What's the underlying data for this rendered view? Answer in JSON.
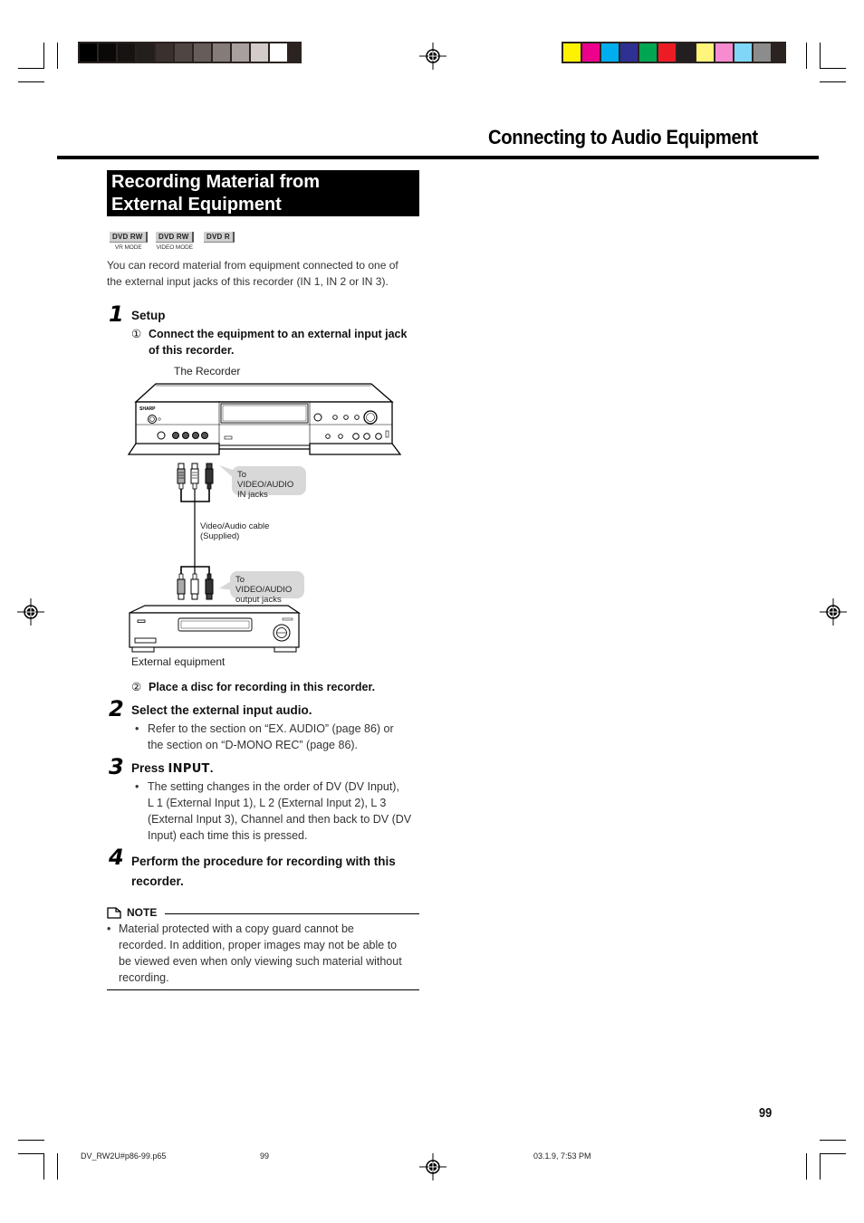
{
  "print_marks": {
    "gray_swatches": [
      "#000000",
      "#0b0908",
      "#161312",
      "#221f1c",
      "#3a302d",
      "#4f4643",
      "#665d5a",
      "#857b78",
      "#a8a09e",
      "#d2cbca",
      "#ffffff"
    ],
    "color_swatches": [
      "#fff200",
      "#ec008c",
      "#00aeef",
      "#2e3192",
      "#00a651",
      "#ed1c24",
      "#231f20",
      "#fff57a",
      "#f68bd0",
      "#7fd6f7",
      "#8c8c8c"
    ]
  },
  "header": {
    "chapter_title": "Connecting to Audio Equipment"
  },
  "section": {
    "title_line1": "Recording Material from",
    "title_line2": "External Equipment",
    "badges": [
      {
        "label": "DVD RW",
        "sub": "VR MODE"
      },
      {
        "label": "DVD RW",
        "sub": "VIDEO MODE"
      },
      {
        "label": "DVD R",
        "sub": ""
      }
    ],
    "intro_line1": "You can record material from equipment connected to one of",
    "intro_line2": "the external input jacks of this recorder (IN 1, IN 2 or IN 3)."
  },
  "steps": [
    {
      "number": "1",
      "heading": "Setup",
      "sub_items": [
        {
          "marker": "①",
          "line1": "Connect the equipment to an external input jack",
          "line2": "of this recorder."
        },
        {
          "marker": "②",
          "line1": "Place a disc for recording in this recorder.",
          "line2": ""
        }
      ]
    },
    {
      "number": "2",
      "heading": "Select the external input audio.",
      "bullet_lines": [
        "Refer to the section on “EX. AUDIO” (page 86) or",
        "the section on “D-MONO REC” (page 86)."
      ]
    },
    {
      "number": "3",
      "heading_prefix": "Press ",
      "heading_key": "INPUT",
      "heading_suffix": ".",
      "bullet_lines": [
        "The setting changes in the order of DV (DV Input),",
        "L 1 (External Input 1), L 2 (External Input 2), L 3",
        "(External Input 3), Channel and then back to DV (DV",
        "Input) each time this is pressed."
      ]
    },
    {
      "number": "4",
      "heading_line1": "Perform the procedure for recording with this",
      "heading_line2": "recorder."
    }
  ],
  "diagram": {
    "recorder_label": "The Recorder",
    "brand": "SHARP",
    "callout_in_line1": "To VIDEO/AUDIO",
    "callout_in_line2": "IN jacks",
    "cable_line1": "Video/Audio cable",
    "cable_line2": "(Supplied)",
    "callout_out_line1": "To VIDEO/AUDIO",
    "callout_out_line2": "output jacks",
    "external_label": "External equipment"
  },
  "note": {
    "heading": "NOTE",
    "lines": [
      "Material protected with a copy guard cannot be",
      "recorded. In addition, proper images may not be able to",
      "be viewed even when only viewing such material without",
      "recording."
    ]
  },
  "page_number": "99",
  "footer": {
    "file": "DV_RW2U#p86-99.p65",
    "page": "99",
    "timestamp": "03.1.9, 7:53 PM"
  }
}
